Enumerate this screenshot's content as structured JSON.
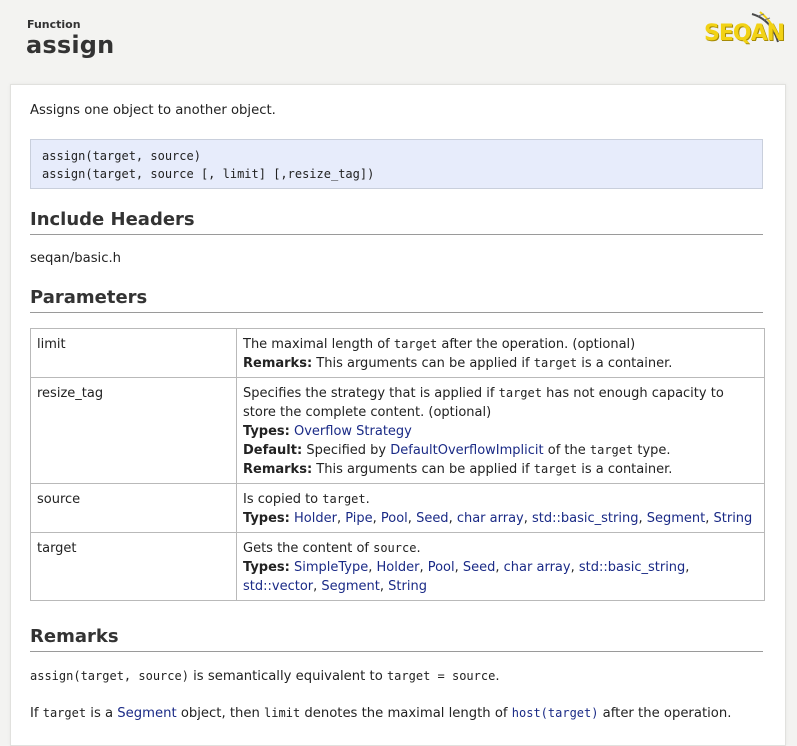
{
  "header": {
    "kind": "Function",
    "title": "assign",
    "logo_text": "SEQAN"
  },
  "summary": "Assigns one object to another object.",
  "signatures": [
    "assign(target, source)",
    "assign(target, source [, limit] [,resize_tag])"
  ],
  "include": {
    "heading": "Include Headers",
    "value": "seqan/basic.h"
  },
  "parameters": {
    "heading": "Parameters",
    "labels": {
      "remarks": "Remarks:",
      "types": "Types:",
      "default": "Default:"
    },
    "rows": [
      {
        "name": "limit",
        "desc_pre": "The maximal length of ",
        "desc_code": "target",
        "desc_post": " after the operation. (optional)",
        "remarks_pre": "This arguments can be applied if ",
        "remarks_code": "target",
        "remarks_post": " is a container."
      },
      {
        "name": "resize_tag",
        "desc_pre": "Specifies the strategy that is applied if ",
        "desc_code": "target",
        "desc_post": " has not enough capacity to store the complete content. (optional)",
        "types": [
          "Overflow Strategy"
        ],
        "default_pre": "Specified by ",
        "default_link": "DefaultOverflowImplicit",
        "default_mid": " of the ",
        "default_code": "target",
        "default_post": " type.",
        "remarks_pre": "This arguments can be applied if ",
        "remarks_code": "target",
        "remarks_post": " is a container."
      },
      {
        "name": "source",
        "desc_pre": "Is copied to ",
        "desc_code": "target",
        "desc_post": ".",
        "types": [
          "Holder",
          "Pipe",
          "Pool",
          "Seed",
          "char array",
          "std::basic_string",
          "Segment",
          "String"
        ]
      },
      {
        "name": "target",
        "desc_pre": "Gets the content of ",
        "desc_code": "source",
        "desc_post": ".",
        "types": [
          "SimpleType",
          "Holder",
          "Pool",
          "Seed",
          "char array",
          "std::basic_string",
          "std::vector",
          "Segment",
          "String"
        ]
      }
    ]
  },
  "remarks": {
    "heading": "Remarks",
    "p1_code1": "assign(target, source)",
    "p1_text": " is semantically equivalent to ",
    "p1_code2": "target = source",
    "p1_end": ".",
    "p2_pre": "If ",
    "p2_code1": "target",
    "p2_mid1": " is a ",
    "p2_link": "Segment",
    "p2_mid2": " object, then ",
    "p2_code2": "limit",
    "p2_mid3": " denotes the maximal length of ",
    "p2_code3": "host(target)",
    "p2_end": " after the operation."
  },
  "colors": {
    "link": "#1a2a86",
    "signature_bg": "#e7ecfb",
    "logo_yellow": "#f2d215"
  }
}
